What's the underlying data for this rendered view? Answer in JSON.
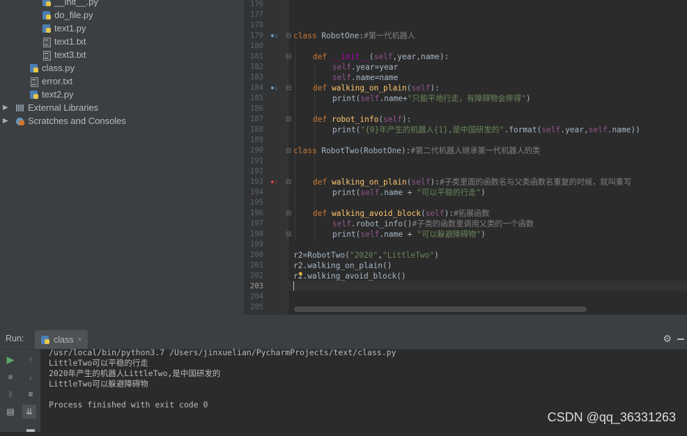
{
  "project_tree": [
    {
      "name": "__init__.py",
      "type": "py",
      "indent": 60
    },
    {
      "name": "do_file.py",
      "type": "py",
      "indent": 60
    },
    {
      "name": "text1.py",
      "type": "py",
      "indent": 60
    },
    {
      "name": "text1.txt",
      "type": "txt",
      "indent": 60
    },
    {
      "name": "text3.txt",
      "type": "txt",
      "indent": 60
    },
    {
      "name": "class.py",
      "type": "py",
      "indent": 42
    },
    {
      "name": "error.txt",
      "type": "txt",
      "indent": 42
    },
    {
      "name": "text2.py",
      "type": "py",
      "indent": 42
    },
    {
      "name": "External Libraries",
      "type": "lib",
      "indent": 22,
      "arrow": "▶"
    },
    {
      "name": "Scratches and Consoles",
      "type": "scratch",
      "indent": 22,
      "arrow": "▶"
    }
  ],
  "editor": {
    "line_numbers": [
      "176",
      "177",
      "178",
      "179",
      "180",
      "181",
      "182",
      "183",
      "184",
      "185",
      "186",
      "187",
      "188",
      "189",
      "190",
      "191",
      "192",
      "193",
      "194",
      "195",
      "196",
      "197",
      "198",
      "199",
      "200",
      "201",
      "202",
      "203",
      "204",
      "205"
    ],
    "current_line": "203"
  },
  "code": {
    "l179_kw": "class ",
    "l179_name": "RobotOne",
    "l179_rest": ":",
    "l179_comment": "#第一代机器人",
    "l181_def": "def ",
    "l181_fn": "__init__",
    "l181_open": "(",
    "l181_self": "self",
    "l181_rest": ",year,name):",
    "l182_self": "self",
    "l182_rest": ".year=year",
    "l183_self": "self",
    "l183_rest": ".name=name",
    "l184_def": "def ",
    "l184_fn": "walking_on_plain",
    "l184_open": "(",
    "l184_self": "self",
    "l184_rest": "):",
    "l185_print": "print(",
    "l185_self": "self",
    "l185_mid": ".name+",
    "l185_str": "\"只能平地行走，有障碍物会摔得\"",
    "l185_close": ")",
    "l187_def": "def ",
    "l187_fn": "robot_info",
    "l187_open": "(",
    "l187_self": "self",
    "l187_rest": "):",
    "l188_print": "print(",
    "l188_str": "\"{0}年产生的机器人{1},是中国研发的\"",
    "l188_mid": ".format(",
    "l188_self1": "self",
    "l188_mid2": ".year,",
    "l188_self2": "self",
    "l188_end": ".name))",
    "l190_kw": "class ",
    "l190_name": "RobotTwo(RobotOne)",
    "l190_rest": ":",
    "l190_comment": "#第二代机器人继承第一代机器人的类",
    "l193_def": "def ",
    "l193_fn": "walking_on_plain",
    "l193_open": "(",
    "l193_self": "self",
    "l193_rest": "):",
    "l193_comment": "#子类里面的函数名与父类函数名重复的时候，就叫重写",
    "l194_print": "print(",
    "l194_self": "self",
    "l194_mid": ".name + ",
    "l194_str": "\"可以平稳的行走\"",
    "l194_close": ")",
    "l196_def": "def ",
    "l196_fn": "walking_avoid_block",
    "l196_open": "(",
    "l196_self": "self",
    "l196_rest": "):",
    "l196_comment": "#拓展函数",
    "l197_self": "self",
    "l197_rest": ".robot_info()",
    "l197_comment": "#子类的函数里调用父类的一个函数",
    "l198_print": "print(",
    "l198_self": "self",
    "l198_mid": ".name + ",
    "l198_str": "\"可以躲避障碍物\"",
    "l198_close": ")",
    "l200_a": "r2=RobotTwo(",
    "l200_s1": "\"2020\"",
    "l200_b": ",",
    "l200_s2": "\"LittleTwo\"",
    "l200_c": ")",
    "l201": "r2.walking_on_plain()",
    "l202": "r2.walking_avoid_block()"
  },
  "run_panel": {
    "label": "Run:",
    "tab_name": "class",
    "tab_close": "×",
    "settings_icon": "gear-icon",
    "console_lines": [
      "/usr/local/bin/python3.7 /Users/jinxuelian/PycharmProjects/text/class.py",
      "LittleTwo可以平稳的行走",
      "2020年产生的机器人LittleTwo,是中国研发的",
      "LittleTwo可以躲避障碍物",
      "",
      "Process finished with exit code 0"
    ]
  },
  "watermark": "CSDN @qq_36331263"
}
